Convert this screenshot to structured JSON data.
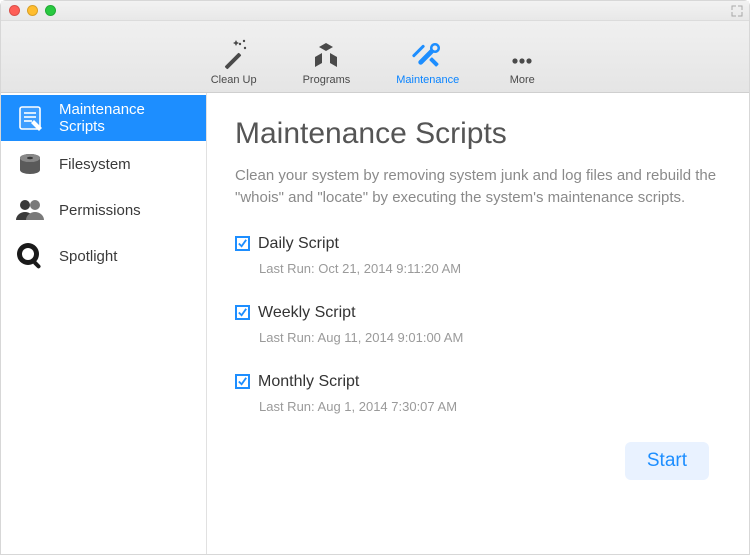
{
  "toolbar": {
    "items": [
      {
        "id": "cleanup",
        "label": "Clean Up",
        "active": false
      },
      {
        "id": "programs",
        "label": "Programs",
        "active": false
      },
      {
        "id": "maintenance",
        "label": "Maintenance",
        "active": true
      },
      {
        "id": "more",
        "label": "More",
        "active": false
      }
    ]
  },
  "sidebar": {
    "items": [
      {
        "id": "maintenance-scripts",
        "label": "Maintenance Scripts",
        "active": true
      },
      {
        "id": "filesystem",
        "label": "Filesystem",
        "active": false
      },
      {
        "id": "permissions",
        "label": "Permissions",
        "active": false
      },
      {
        "id": "spotlight",
        "label": "Spotlight",
        "active": false
      }
    ]
  },
  "main": {
    "title": "Maintenance Scripts",
    "description": "Clean your system by removing system junk and log files and rebuild the \"whois\" and \"locate\" by executing the system's maintenance scripts.",
    "scripts": [
      {
        "name": "Daily Script",
        "checked": true,
        "last_run_label": "Last Run: Oct 21, 2014 9:11:20 AM"
      },
      {
        "name": "Weekly Script",
        "checked": true,
        "last_run_label": "Last Run: Aug 11, 2014 9:01:00 AM"
      },
      {
        "name": "Monthly Script",
        "checked": true,
        "last_run_label": "Last Run: Aug 1, 2014 7:30:07 AM"
      }
    ],
    "start_label": "Start"
  },
  "colors": {
    "accent": "#1d8eff"
  }
}
